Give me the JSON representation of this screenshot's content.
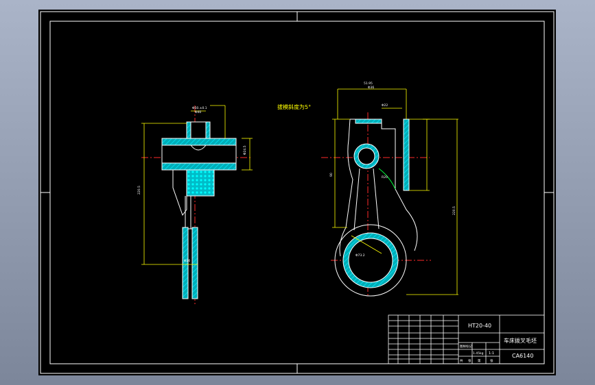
{
  "note": "拔模斜度为5°",
  "title_block": {
    "material": "HT20-40",
    "part_name": "车床拨叉毛坯",
    "model": "CA6140",
    "scale": "1:1",
    "weight": "1.45kg",
    "drawing_no": "图样标记",
    "sheet_info": [
      "共",
      "张",
      "第",
      "张"
    ]
  },
  "dims": {
    "front_top1": "Φ50.±0.1",
    "front_top2": "Φ40",
    "front_right": "Φ24.5",
    "front_height": "220.5",
    "front_bottom": "Φ20",
    "side_top1": "51.95",
    "side_top2": "Φ36",
    "side_small": "Φ22",
    "side_radius": "R20",
    "side_big": "Φ73.2",
    "side_total": "220.5",
    "side_left": "90"
  },
  "colors": {
    "line": "#ffffff",
    "hatch": "#00d9e8",
    "center": "#ff2a2a",
    "dim": "#ffff00",
    "green": "#00ff3c"
  }
}
